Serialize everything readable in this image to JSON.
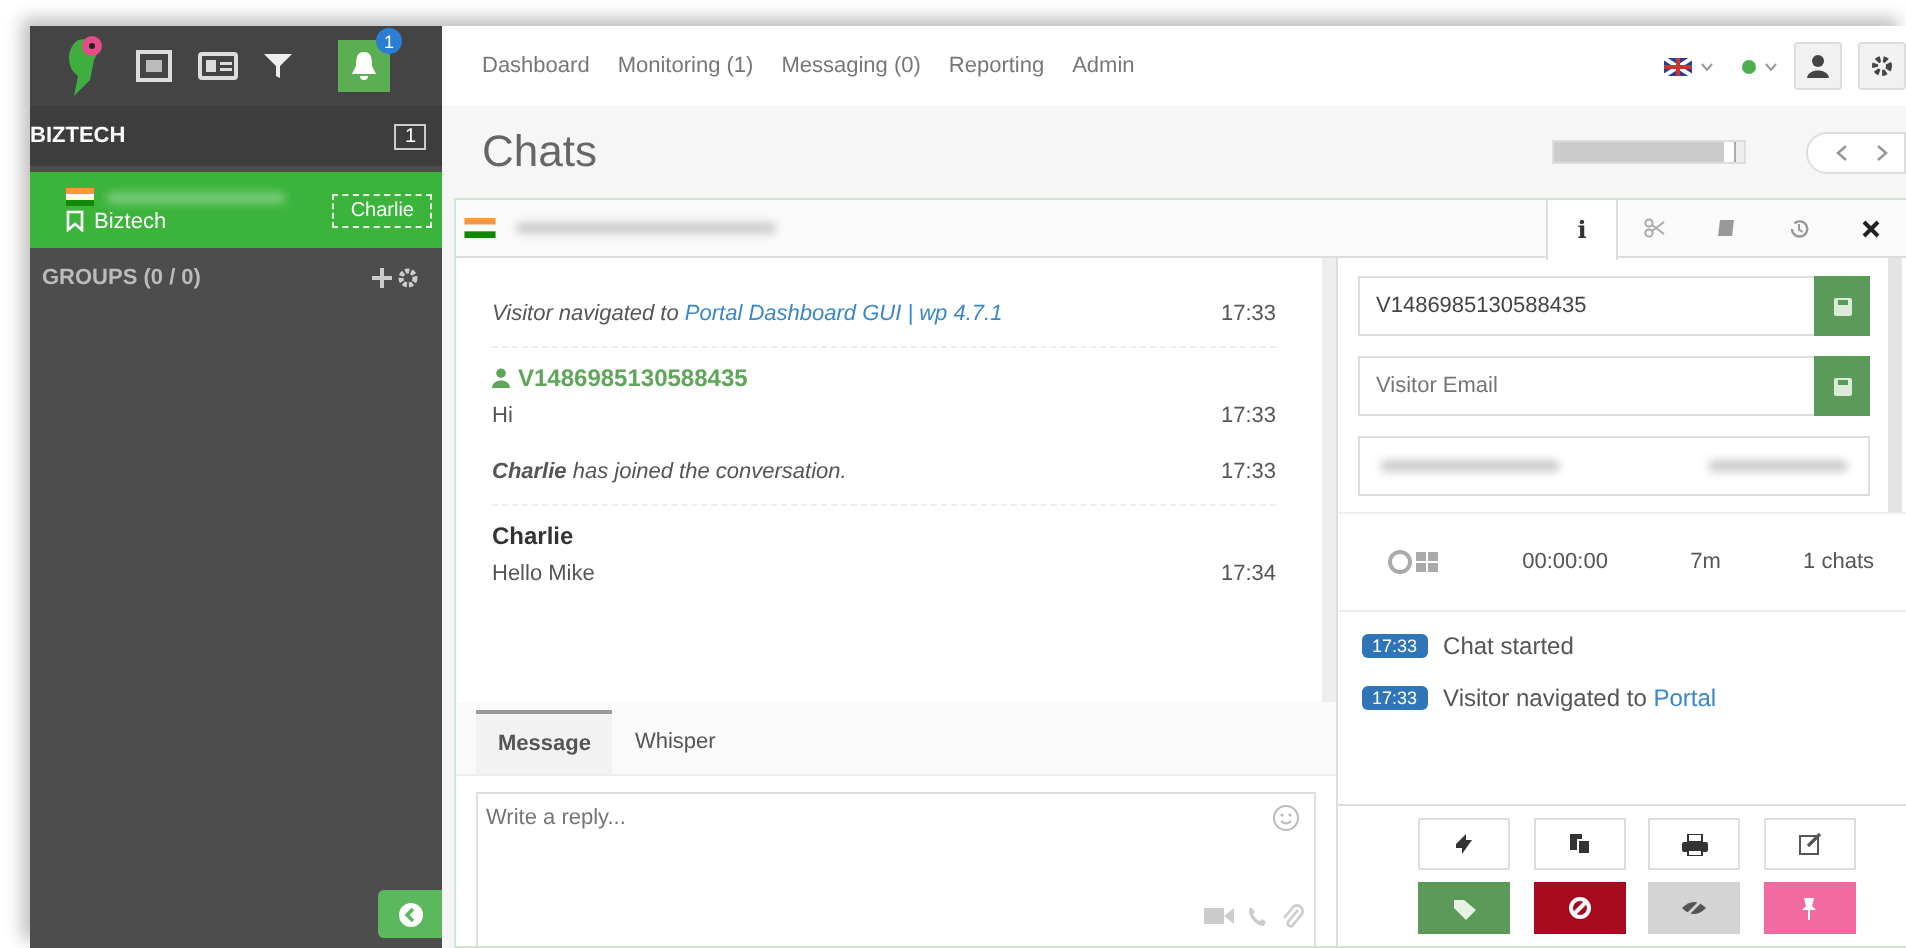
{
  "sidebar": {
    "department": "BIZTECH",
    "department_count": "1",
    "notification_badge": "1",
    "chats": [
      {
        "visitor_tag": "Biztech",
        "operator": "Charlie",
        "selected": true
      }
    ],
    "groups_label": "GROUPS (0 / 0)"
  },
  "nav": [
    "Dashboard",
    "Monitoring (1)",
    "Messaging (0)",
    "Reporting",
    "Admin"
  ],
  "status_online": true,
  "page_title": "Chats",
  "zoom_slider": {
    "level": 0.95
  },
  "info_tabs": [
    {
      "kind": "info",
      "label": "i",
      "selected": true
    },
    {
      "kind": "scissors",
      "selected": false
    },
    {
      "kind": "notes",
      "selected": false
    },
    {
      "kind": "history",
      "selected": false
    },
    {
      "kind": "close",
      "selected": false
    }
  ],
  "messages": [
    {
      "kind": "event",
      "text": "Visitor navigated to ",
      "link": "Portal Dashboard GUI | wp 4.7.1",
      "time": "17:33"
    },
    {
      "kind": "visitor",
      "author": "V1486985130588435",
      "text": "Hi",
      "time": "17:33"
    },
    {
      "kind": "system",
      "text": "**Charlie** has joined the conversation.",
      "time": "17:33"
    },
    {
      "kind": "operator",
      "author": "Charlie",
      "text": "Hello Mike",
      "time": "17:34"
    }
  ],
  "composer_tabs": [
    {
      "label": "Message",
      "selected": true
    },
    {
      "label": "Whisper",
      "selected": false
    }
  ],
  "reply": {
    "placeholder": "Write a reply..."
  },
  "visitor_nick": {
    "value": "V1486985130588435"
  },
  "visitor_email": {
    "placeholder": "Visitor Email"
  },
  "stats": [
    "00:00:00",
    "7m",
    "1 chats"
  ],
  "timeline": [
    {
      "time": "17:33",
      "text": "Chat started"
    },
    {
      "time": "17:33",
      "text": "Visitor navigated to ",
      "link": "Portal"
    }
  ],
  "tools": [
    {
      "kind": "transfer"
    },
    {
      "kind": "copy"
    },
    {
      "kind": "print"
    },
    {
      "kind": "edit"
    }
  ],
  "actions": [
    {
      "kind": "tag",
      "color": "#5c9a5a"
    },
    {
      "kind": "block",
      "color": "#a50a1f"
    },
    {
      "kind": "hide",
      "color": "#d4d4d4"
    },
    {
      "kind": "pin",
      "color": "#f26ba0"
    }
  ]
}
